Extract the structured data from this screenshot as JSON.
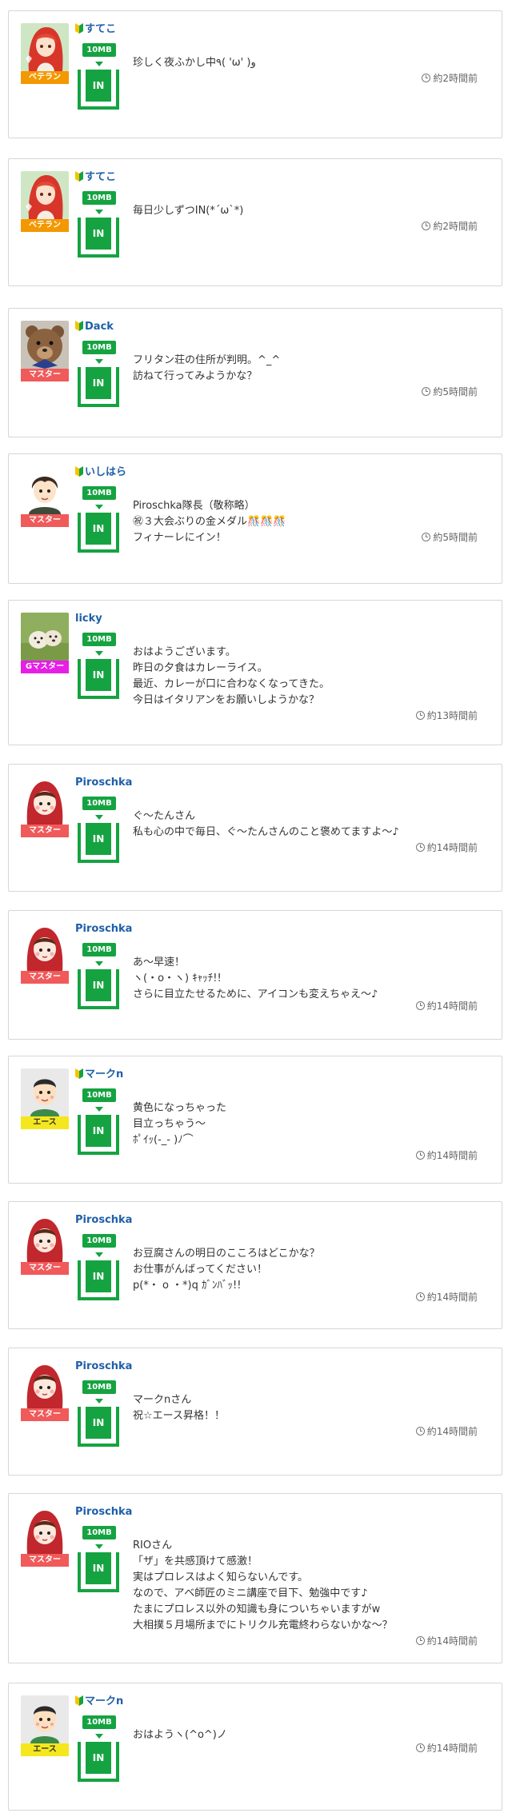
{
  "size_label": "10MB",
  "in_label": "IN",
  "posts": [
    {
      "user": "すてこ",
      "beginner": true,
      "rank": "ベテラン",
      "rank_color": "#f39800",
      "avatar": "anime-girl",
      "message": "珍しく夜ふかし中٩( 'ω' )و",
      "time": "約2時間前"
    },
    {
      "user": "すてこ",
      "beginner": true,
      "rank": "ベテラン",
      "rank_color": "#f39800",
      "avatar": "anime-girl",
      "message": "毎日少しずつIN(*´ω`*)",
      "time": "約2時間前"
    },
    {
      "user": "Dack",
      "beginner": true,
      "rank": "マスター",
      "rank_color": "#f05a5a",
      "avatar": "teddy-bear",
      "message": "フリタン荘の住所が判明。^_^\n訪ねて行ってみようかな？",
      "time": "約5時間前"
    },
    {
      "user": "いしはら",
      "beginner": true,
      "rank": "マスター",
      "rank_color": "#f05a5a",
      "avatar": "cartoon-boy",
      "message": "Piroschka隊長（敬称略）\n㊗３大会ぶりの金メダル",
      "message_extra": "🎊🎊🎊",
      "message_tail": "\nフィナーレにイン！",
      "time": "約5時間前"
    },
    {
      "user": "licky",
      "beginner": false,
      "rank": "Gマスター",
      "rank_color": "#e61ee6",
      "avatar": "dogs",
      "message": "おはようございます。\n昨日の夕食はカレーライス。\n最近、カレーが口に合わなくなってきた。\n今日はイタリアンをお願いしようかな？",
      "time": "約13時間前"
    },
    {
      "user": "Piroschka",
      "beginner": false,
      "rank": "マスター",
      "rank_color": "#f05a5a",
      "avatar": "red-hood",
      "message": "ぐ〜たんさん\n私も心の中で毎日、ぐ〜たんさんのこと褒めてますよ〜♪",
      "time": "約14時間前"
    },
    {
      "user": "Piroschka",
      "beginner": false,
      "rank": "マスター",
      "rank_color": "#f05a5a",
      "avatar": "red-hood",
      "message": "あ〜早速！\nヽ(・o・ヽ) ｷｬｯﾁ!!\nさらに目立たせるために、アイコンも変えちゃえ〜♪",
      "time": "約14時間前"
    },
    {
      "user": "マークn",
      "beginner": true,
      "rank": "エース",
      "rank_color": "#f5e71e",
      "avatar": "cartoon-man",
      "message": "黄色になっちゃった\n目立っちゃう〜\nﾎﾟｲｯ(-_-  )ﾉ⌒",
      "time": "約14時間前"
    },
    {
      "user": "Piroschka",
      "beginner": false,
      "rank": "マスター",
      "rank_color": "#f05a5a",
      "avatar": "red-hood",
      "message": "お豆腐さんの明日のこころはどこかな？\nお仕事がんばってください！\np(*・ o ・*)q ｶﾞﾝﾊﾞｯ!!",
      "time": "約14時間前"
    },
    {
      "user": "Piroschka",
      "beginner": false,
      "rank": "マスター",
      "rank_color": "#f05a5a",
      "avatar": "red-hood",
      "message": "マークnさん\n祝☆エース昇格！！",
      "time": "約14時間前"
    },
    {
      "user": "Piroschka",
      "beginner": false,
      "rank": "マスター",
      "rank_color": "#f05a5a",
      "avatar": "red-hood",
      "message": "RIOさん\n「ザ」を共感頂けて感激！\n実はプロレスはよく知らないんです。\nなので、アベ師匠のミニ講座で目下、勉強中です♪\nたまにプロレス以外の知識も身についちゃいますがw\n大相撲５月場所までにトリクル充電終わらないかな〜？",
      "time": "約14時間前"
    },
    {
      "user": "マークn",
      "beginner": true,
      "rank": "エース",
      "rank_color": "#f5e71e",
      "avatar": "cartoon-man",
      "message": "おはようヽ(^o^)ノ",
      "time": "約14時間前"
    }
  ]
}
